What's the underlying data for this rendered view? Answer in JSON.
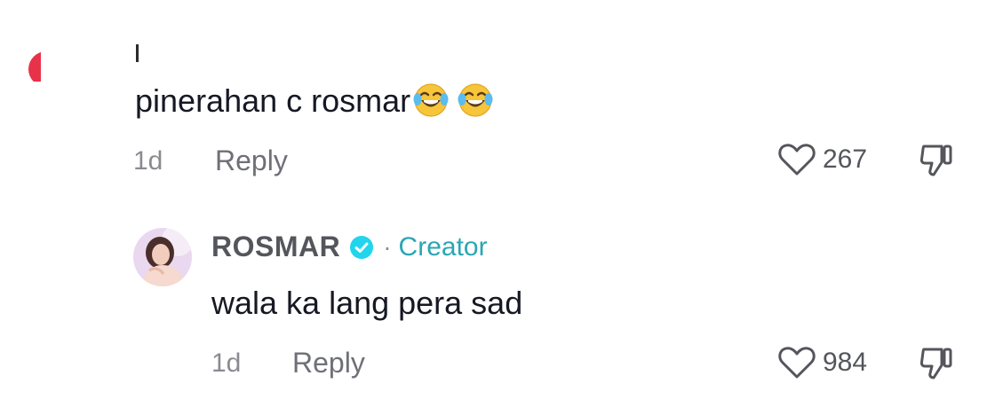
{
  "comment1": {
    "cursor_char": "I",
    "text": "pinerahan c rosmar",
    "emojis": [
      "face-with-tears-of-joy-icon",
      "face-with-tears-of-joy-icon"
    ],
    "time": "1d",
    "reply_label": "Reply",
    "likes": "267"
  },
  "comment2": {
    "author": "ROSMAR",
    "separator": "·",
    "badge": "Creator",
    "text": "wala ka lang pera sad",
    "time": "1d",
    "reply_label": "Reply",
    "likes": "984"
  },
  "colors": {
    "text": "#161823",
    "muted": "#8a8b91",
    "creator": "#2aa6b4",
    "verified": "#20d5ec",
    "edge_avatar": "#e8324a"
  }
}
